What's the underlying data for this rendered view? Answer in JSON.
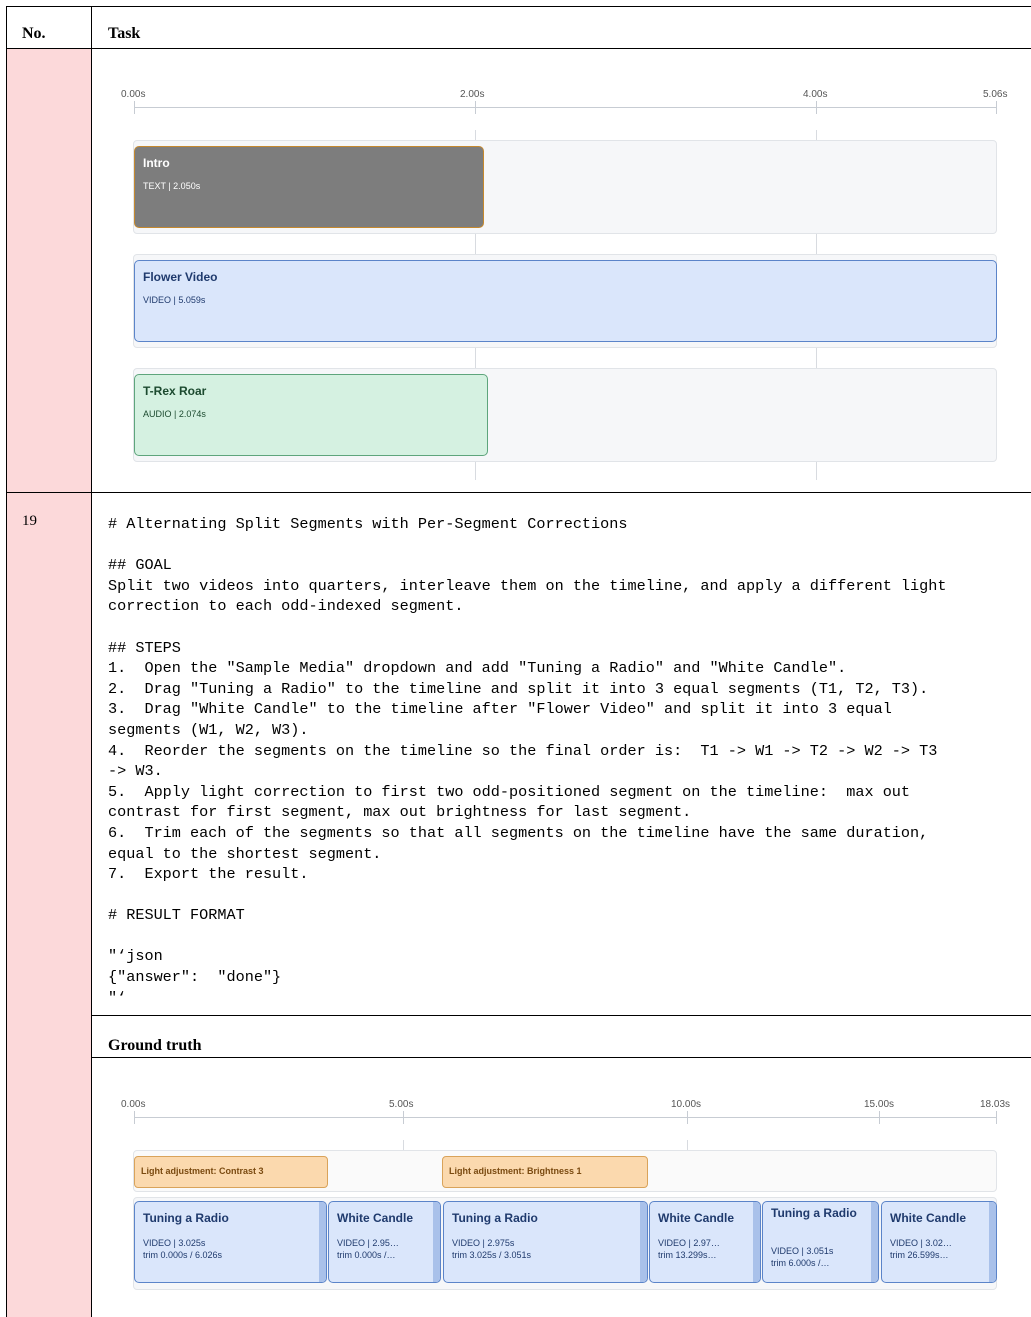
{
  "header": {
    "col_no": "No.",
    "col_task": "Task"
  },
  "row": {
    "number": "19",
    "task_timeline": {
      "ruler_labels": [
        "0.00s",
        "2.00s",
        "4.00s",
        "5.06s"
      ],
      "clips": [
        {
          "title": "Intro",
          "info": "TEXT | 2.050s"
        },
        {
          "title": "Flower Video",
          "info": "VIDEO | 5.059s"
        },
        {
          "title": "T-Rex Roar",
          "info": "AUDIO | 2.074s"
        }
      ]
    },
    "task_text": [
      "# Alternating Split Segments with Per-Segment Corrections",
      "",
      "## GOAL",
      "Split two videos into quarters, interleave them on the timeline, and apply a different light",
      "correction to each odd-indexed segment.",
      "",
      "## STEPS",
      "1.  Open the \"Sample Media\" dropdown and add \"Tuning a Radio\" and \"White Candle\".",
      "2.  Drag \"Tuning a Radio\" to the timeline and split it into 3 equal segments (T1, T2, T3).",
      "3.  Drag \"White Candle\" to the timeline after \"Flower Video\" and split it into 3 equal",
      "segments (W1, W2, W3).",
      "4.  Reorder the segments on the timeline so the final order is:  T1 -> W1 -> T2 -> W2 -> T3",
      "-> W3.",
      "5.  Apply light correction to first two odd-positioned segment on the timeline:  max out",
      "contrast for first segment, max out brightness for last segment.",
      "6.  Trim each of the segments so that all segments on the timeline have the same duration,",
      "equal to the shortest segment.",
      "7.  Export the result.",
      "",
      "# RESULT FORMAT",
      "",
      "\"‘json",
      "{\"answer\":  \"done\"}",
      "\"‘"
    ],
    "ground_truth": {
      "title": "Ground truth",
      "ruler_labels": [
        "0.00s",
        "5.00s",
        "10.00s",
        "15.00s",
        "18.03s"
      ],
      "adjustments": [
        {
          "label": "Light adjustment: Contrast 3"
        },
        {
          "label": "Light adjustment: Brightness 1"
        }
      ],
      "clips": [
        {
          "title": "Tuning a Radio",
          "info": "VIDEO | 3.025s",
          "trim": "trim 0.000s / 6.026s"
        },
        {
          "title": "White Candle",
          "info": "VIDEO | 2.95…",
          "trim": "trim 0.000s /…"
        },
        {
          "title": "Tuning a Radio",
          "info": "VIDEO | 2.975s",
          "trim": "trim 3.025s / 3.051s"
        },
        {
          "title": "White Candle",
          "info": "VIDEO | 2.97…",
          "trim": "trim 13.299s…"
        },
        {
          "title": "Tuning a Radio",
          "info": "VIDEO | 3.051s",
          "trim": "trim 6.000s /…"
        },
        {
          "title": "White Candle",
          "info": "VIDEO | 3.02…",
          "trim": "trim 26.599s…"
        }
      ]
    }
  },
  "colors": {
    "row_number_bg": "#fcd9da",
    "text_clip": "#7d7d7d",
    "video_clip": "#dae6fb",
    "audio_clip": "#d5f1e1",
    "adjustment": "#fbd9ae"
  }
}
